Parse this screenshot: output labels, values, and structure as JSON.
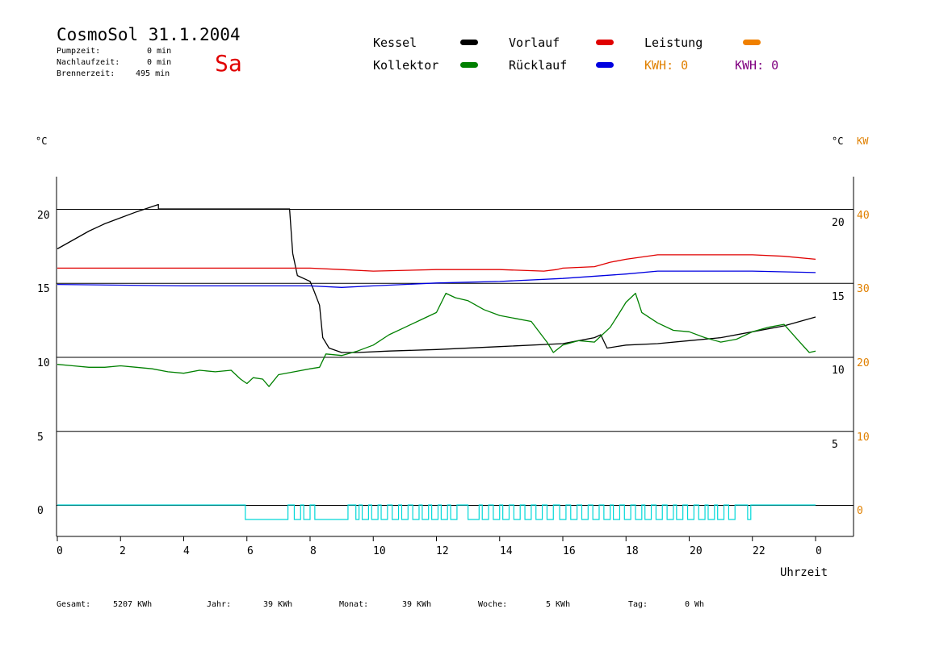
{
  "header": {
    "title": "CosmoSol 31.1.2004",
    "day": "Sa",
    "stats": [
      {
        "label": "Pumpzeit:",
        "value": "0 min"
      },
      {
        "label": "Nachlaufzeit:",
        "value": "0 min"
      },
      {
        "label": "Brennerzeit:",
        "value": "495 min"
      }
    ]
  },
  "legend": {
    "items": [
      {
        "label": "Kessel",
        "color": "#000000"
      },
      {
        "label": "Vorlauf",
        "color": "#e00000"
      },
      {
        "label": "Leistung",
        "color": "#f08000"
      },
      {
        "label": "Kollektor",
        "color": "#008000"
      },
      {
        "label": "Rücklauf",
        "color": "#0000e0"
      }
    ],
    "kwh1": "KWH: 0",
    "kwh1_color": "#e08000",
    "kwh2": "KWH: 0",
    "kwh2_color": "#800080"
  },
  "axes": {
    "left_unit": "°C",
    "right_unit": "°C",
    "right_unit2": "KW",
    "right_unit2_color": "#e08000",
    "xlabel": "Uhrzeit",
    "x_ticks": [
      "0",
      "2",
      "4",
      "6",
      "8",
      "10",
      "12",
      "14",
      "16",
      "18",
      "20",
      "22",
      "0"
    ],
    "left_ticks": [
      "20",
      "15",
      "10",
      "5",
      "0"
    ],
    "right_ticks": [
      "20",
      "15",
      "10",
      "5"
    ],
    "kw_ticks": [
      "40",
      "30",
      "20",
      "10",
      "0"
    ]
  },
  "footer": [
    {
      "label": "Gesamt:",
      "value": "5207 KWh"
    },
    {
      "label": "Jahr:",
      "value": "39 KWh"
    },
    {
      "label": "Monat:",
      "value": "39 KWh"
    },
    {
      "label": "Woche:",
      "value": "5 KWh"
    },
    {
      "label": "Tag:",
      "value": "0 Wh"
    }
  ],
  "chart_data": {
    "type": "line",
    "xlabel": "Uhrzeit",
    "ylabel": "°C",
    "xlim": [
      0,
      24
    ],
    "ylim": [
      -2,
      22
    ],
    "grid_y": [
      20,
      15,
      10,
      5,
      0
    ],
    "series": [
      {
        "name": "Kessel",
        "color": "#000000",
        "points": [
          [
            0,
            17.3
          ],
          [
            0.5,
            17.9
          ],
          [
            1,
            18.5
          ],
          [
            1.5,
            19
          ],
          [
            2,
            19.4
          ],
          [
            2.5,
            19.8
          ],
          [
            3.2,
            20.3
          ],
          [
            3.2,
            20
          ],
          [
            6.4,
            20
          ],
          [
            7.35,
            20
          ],
          [
            7.45,
            17
          ],
          [
            7.6,
            15.5
          ],
          [
            8,
            15.1
          ],
          [
            8.1,
            14.6
          ],
          [
            8.3,
            13.5
          ],
          [
            8.4,
            11.3
          ],
          [
            8.6,
            10.6
          ],
          [
            9,
            10.3
          ],
          [
            9.5,
            10.3
          ],
          [
            10.5,
            10.4
          ],
          [
            12,
            10.5
          ],
          [
            14,
            10.7
          ],
          [
            16,
            10.9
          ],
          [
            16.5,
            11.1
          ],
          [
            17,
            11.3
          ],
          [
            17.2,
            11.5
          ],
          [
            17.4,
            10.6
          ],
          [
            18,
            10.8
          ],
          [
            19,
            10.9
          ],
          [
            20,
            11.1
          ],
          [
            21,
            11.3
          ],
          [
            22,
            11.7
          ],
          [
            23,
            12.1
          ],
          [
            24,
            12.7
          ]
        ]
      },
      {
        "name": "Vorlauf",
        "color": "#e00000",
        "points": [
          [
            0,
            16
          ],
          [
            4,
            16
          ],
          [
            8,
            16
          ],
          [
            9,
            15.9
          ],
          [
            10,
            15.8
          ],
          [
            12,
            15.9
          ],
          [
            14,
            15.9
          ],
          [
            15.4,
            15.8
          ],
          [
            15.8,
            15.9
          ],
          [
            16,
            16
          ],
          [
            17,
            16.1
          ],
          [
            17.5,
            16.4
          ],
          [
            18,
            16.6
          ],
          [
            19,
            16.9
          ],
          [
            20,
            16.9
          ],
          [
            22,
            16.9
          ],
          [
            23,
            16.8
          ],
          [
            24,
            16.6
          ]
        ]
      },
      {
        "name": "Rücklauf",
        "color": "#0000e0",
        "points": [
          [
            0,
            14.9
          ],
          [
            4,
            14.8
          ],
          [
            6,
            14.8
          ],
          [
            8,
            14.8
          ],
          [
            9,
            14.7
          ],
          [
            10,
            14.8
          ],
          [
            11,
            14.9
          ],
          [
            12,
            15
          ],
          [
            14,
            15.1
          ],
          [
            16,
            15.3
          ],
          [
            18,
            15.6
          ],
          [
            19,
            15.8
          ],
          [
            20,
            15.8
          ],
          [
            22,
            15.8
          ],
          [
            24,
            15.7
          ]
        ]
      },
      {
        "name": "Kollektor",
        "color": "#008000",
        "points": [
          [
            0,
            9.5
          ],
          [
            0.5,
            9.4
          ],
          [
            1,
            9.3
          ],
          [
            1.5,
            9.3
          ],
          [
            2,
            9.4
          ],
          [
            2.5,
            9.3
          ],
          [
            3,
            9.2
          ],
          [
            3.5,
            9.0
          ],
          [
            4,
            8.9
          ],
          [
            4.5,
            9.1
          ],
          [
            5,
            9.0
          ],
          [
            5.5,
            9.1
          ],
          [
            5.8,
            8.5
          ],
          [
            6,
            8.2
          ],
          [
            6.2,
            8.6
          ],
          [
            6.5,
            8.5
          ],
          [
            6.7,
            8.0
          ],
          [
            7,
            8.8
          ],
          [
            7.5,
            9.0
          ],
          [
            8,
            9.2
          ],
          [
            8.3,
            9.3
          ],
          [
            8.5,
            10.2
          ],
          [
            9,
            10.1
          ],
          [
            9.5,
            10.4
          ],
          [
            10,
            10.8
          ],
          [
            10.5,
            11.5
          ],
          [
            11,
            12.0
          ],
          [
            11.5,
            12.5
          ],
          [
            12,
            13.0
          ],
          [
            12.3,
            14.3
          ],
          [
            12.6,
            14.0
          ],
          [
            13,
            13.8
          ],
          [
            13.5,
            13.2
          ],
          [
            14,
            12.8
          ],
          [
            14.5,
            12.6
          ],
          [
            15,
            12.4
          ],
          [
            15.5,
            11.0
          ],
          [
            15.7,
            10.3
          ],
          [
            16,
            10.8
          ],
          [
            16.5,
            11.1
          ],
          [
            17,
            11.0
          ],
          [
            17.5,
            12.0
          ],
          [
            17.8,
            13.0
          ],
          [
            18,
            13.7
          ],
          [
            18.3,
            14.3
          ],
          [
            18.5,
            13.0
          ],
          [
            19,
            12.3
          ],
          [
            19.5,
            11.8
          ],
          [
            20,
            11.7
          ],
          [
            20.5,
            11.3
          ],
          [
            21,
            11.0
          ],
          [
            21.5,
            11.2
          ],
          [
            22,
            11.7
          ],
          [
            22.5,
            12.0
          ],
          [
            23,
            12.2
          ],
          [
            23.5,
            11.0
          ],
          [
            23.8,
            10.3
          ],
          [
            24,
            10.4
          ]
        ]
      }
    ],
    "pump_signal": {
      "name": "Pumpe",
      "color": "#00d8d8",
      "intervals": [
        [
          5.95,
          7.3
        ],
        [
          7.5,
          7.7
        ],
        [
          7.8,
          8.0
        ],
        [
          8.15,
          9.2
        ],
        [
          9.45,
          9.55
        ],
        [
          9.65,
          9.85
        ],
        [
          9.95,
          10.15
        ],
        [
          10.25,
          10.45
        ],
        [
          10.6,
          10.8
        ],
        [
          10.9,
          11.1
        ],
        [
          11.25,
          11.45
        ],
        [
          11.55,
          11.75
        ],
        [
          11.85,
          12.05
        ],
        [
          12.15,
          12.35
        ],
        [
          12.45,
          12.65
        ],
        [
          13.0,
          13.35
        ],
        [
          13.45,
          13.65
        ],
        [
          13.8,
          14.0
        ],
        [
          14.1,
          14.3
        ],
        [
          14.45,
          14.65
        ],
        [
          14.8,
          15.0
        ],
        [
          15.15,
          15.35
        ],
        [
          15.5,
          15.7
        ],
        [
          15.9,
          16.1
        ],
        [
          16.25,
          16.45
        ],
        [
          16.6,
          16.8
        ],
        [
          16.95,
          17.15
        ],
        [
          17.3,
          17.5
        ],
        [
          17.6,
          17.8
        ],
        [
          17.95,
          18.15
        ],
        [
          18.3,
          18.5
        ],
        [
          18.6,
          18.8
        ],
        [
          18.95,
          19.15
        ],
        [
          19.3,
          19.5
        ],
        [
          19.6,
          19.8
        ],
        [
          19.95,
          20.15
        ],
        [
          20.3,
          20.5
        ],
        [
          20.6,
          20.8
        ],
        [
          20.9,
          21.1
        ],
        [
          21.25,
          21.45
        ],
        [
          21.85,
          21.95
        ]
      ]
    }
  }
}
